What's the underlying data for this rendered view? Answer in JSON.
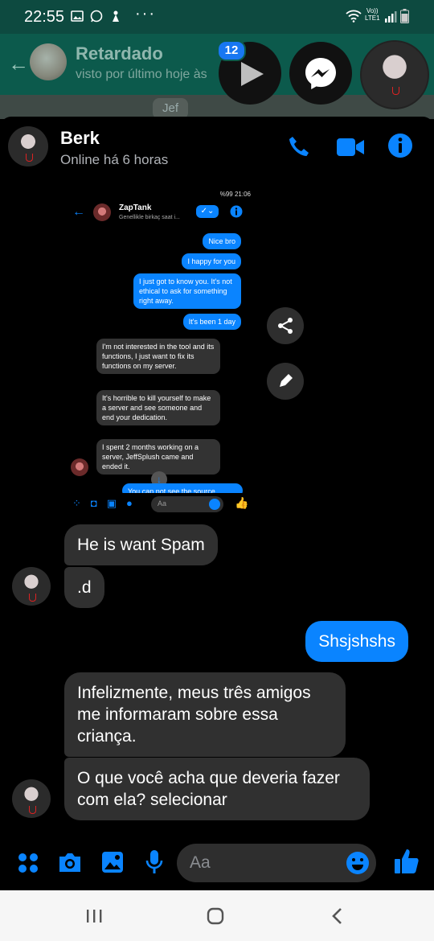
{
  "status_bar": {
    "time": "22:55",
    "net_label_1": "Vo))",
    "net_label_2": "LTE1"
  },
  "whatsapp_bg": {
    "contact_name": "Retardado",
    "last_seen": "visto por último hoje às",
    "message_sender": "Jef",
    "unread_badge": "12"
  },
  "conversation": {
    "contact_name": "Berk",
    "status": "Online há 6 horas"
  },
  "screenshot": {
    "status": "%99 21:06",
    "title": "ZapTank",
    "subtitle": "Genellikle birkaç saat i...",
    "my_messages": [
      "Nice bro",
      "I happy for you",
      "I just got to know you. It's not ethical to ask for something right away.",
      "It's been 1 day"
    ],
    "their_messages": [
      "I'm not interested in the tool and its functions, I just want to fix its functions on my server.",
      "It's horrible to kill yourself to make a server and see someone and end your dedication.",
      "I spent 2 months working on a server, JeffSplush came and ended it."
    ],
    "partial_message": "You can not see the source",
    "composer_placeholder": "Aa"
  },
  "messages": [
    {
      "from": "other",
      "text": "He is want Spam"
    },
    {
      "from": "other",
      "text": ".d"
    },
    {
      "from": "me",
      "text": "Shsjshshs"
    },
    {
      "from": "other",
      "text": "Infelizmente, meus três amigos me informaram sobre essa criança."
    },
    {
      "from": "other",
      "text": "O que você acha que deveria fazer com ela? selecionar"
    }
  ],
  "composer": {
    "placeholder": "Aa"
  },
  "colors": {
    "accent": "#0a84ff",
    "whatsapp_green": "#0c5a4c",
    "bubble_other": "#303030"
  }
}
